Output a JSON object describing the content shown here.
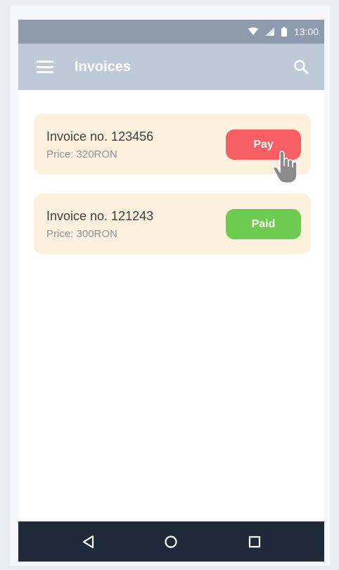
{
  "status_bar": {
    "time": "13:00"
  },
  "app_bar": {
    "title": "Invoices"
  },
  "invoices": [
    {
      "title": "Invoice no. 123456",
      "price": "Price: 320RON",
      "action_label": "Pay"
    },
    {
      "title": "Invoice no. 121243",
      "price": "Price: 300RON",
      "action_label": "Paid"
    }
  ],
  "colors": {
    "status_bar": "#8e9bae",
    "app_bar": "#bfcad8",
    "card_bg": "#fdf0dd",
    "pay_button": "#f65f63",
    "paid_button": "#6ccc50",
    "nav_bar": "#1f2b3a"
  },
  "icons": [
    "wifi-icon",
    "signal-icon",
    "battery-icon",
    "menu-icon",
    "search-icon",
    "hand-cursor-icon",
    "back-icon",
    "home-icon",
    "recents-icon"
  ]
}
